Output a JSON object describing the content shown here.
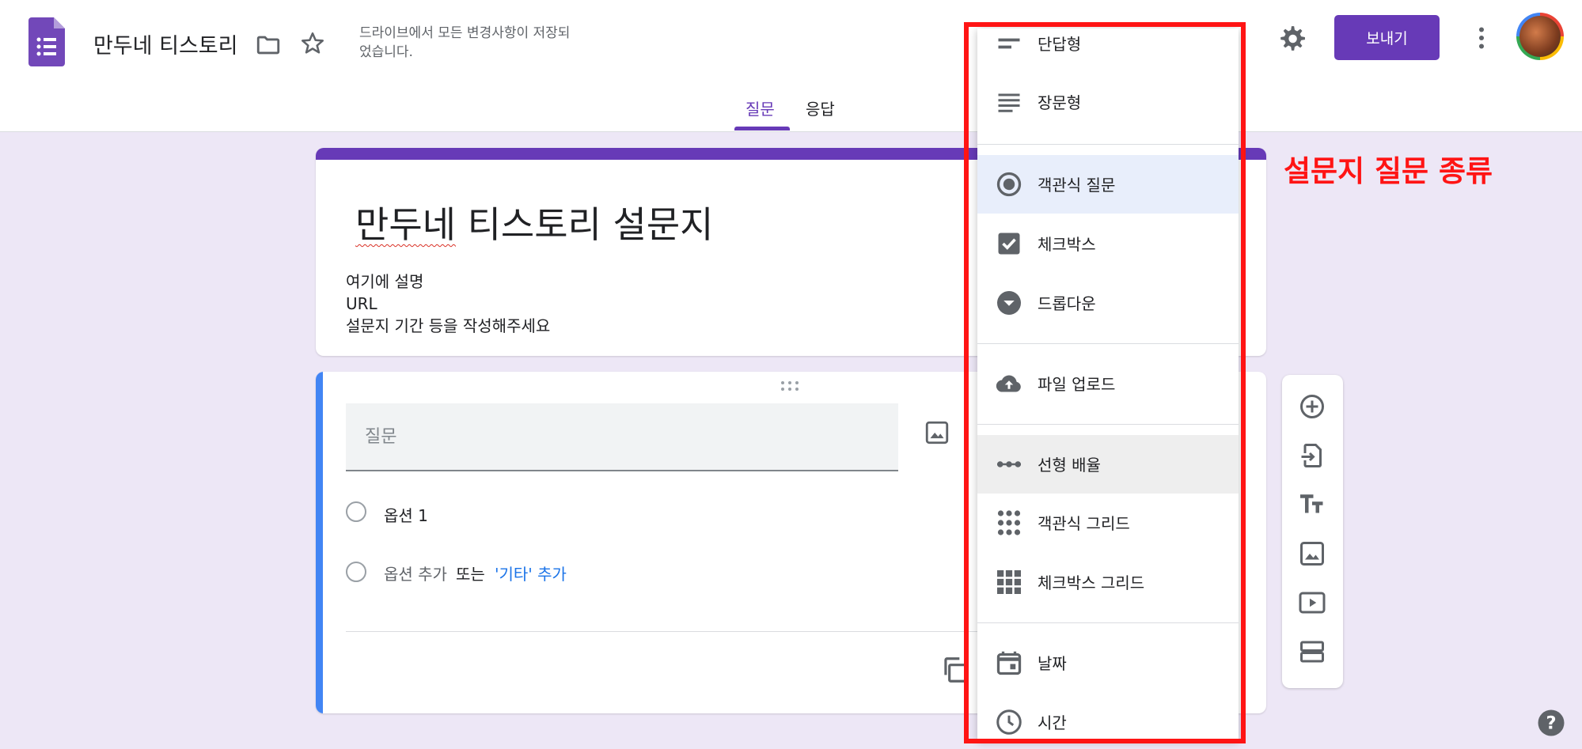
{
  "header": {
    "doc_title": "만두네 티스토리",
    "save_status": "드라이브에서 모든 변경사항이 저장되었습니다.",
    "send_label": "보내기",
    "tabs": [
      {
        "label": "질문",
        "active": true
      },
      {
        "label": "응답",
        "active": false
      }
    ]
  },
  "form": {
    "title_part1": "만두네",
    "title_part2": " 티스토리 설문지",
    "description_lines": [
      "여기에 설명",
      "URL",
      "설문지 기간 등을 작성해주세요"
    ]
  },
  "question": {
    "placeholder": "질문",
    "option_1": "옵션 1",
    "add_option": "옵션 추가",
    "or": "또는",
    "add_other": "'기타' 추가"
  },
  "type_menu": {
    "items": [
      {
        "label": "단답형",
        "icon": "short-answer-icon"
      },
      {
        "label": "장문형",
        "icon": "paragraph-icon"
      },
      {
        "label": "객관식 질문",
        "icon": "radio-button-icon",
        "selected": true
      },
      {
        "label": "체크박스",
        "icon": "checkbox-icon"
      },
      {
        "label": "드롭다운",
        "icon": "dropdown-icon"
      },
      {
        "label": "파일 업로드",
        "icon": "cloud-upload-icon"
      },
      {
        "label": "선형 배율",
        "icon": "linear-scale-icon",
        "hover": true
      },
      {
        "label": "객관식 그리드",
        "icon": "dot-grid-icon"
      },
      {
        "label": "체크박스 그리드",
        "icon": "square-grid-icon"
      },
      {
        "label": "날짜",
        "icon": "calendar-icon"
      },
      {
        "label": "시간",
        "icon": "clock-icon"
      }
    ]
  },
  "annotation": {
    "label": "설문지 질문 종류",
    "color": "#ff1414"
  },
  "colors": {
    "accent": "#673ab7",
    "background": "#ede7f6",
    "question_accent": "#4285f4",
    "link": "#1a73e8"
  }
}
